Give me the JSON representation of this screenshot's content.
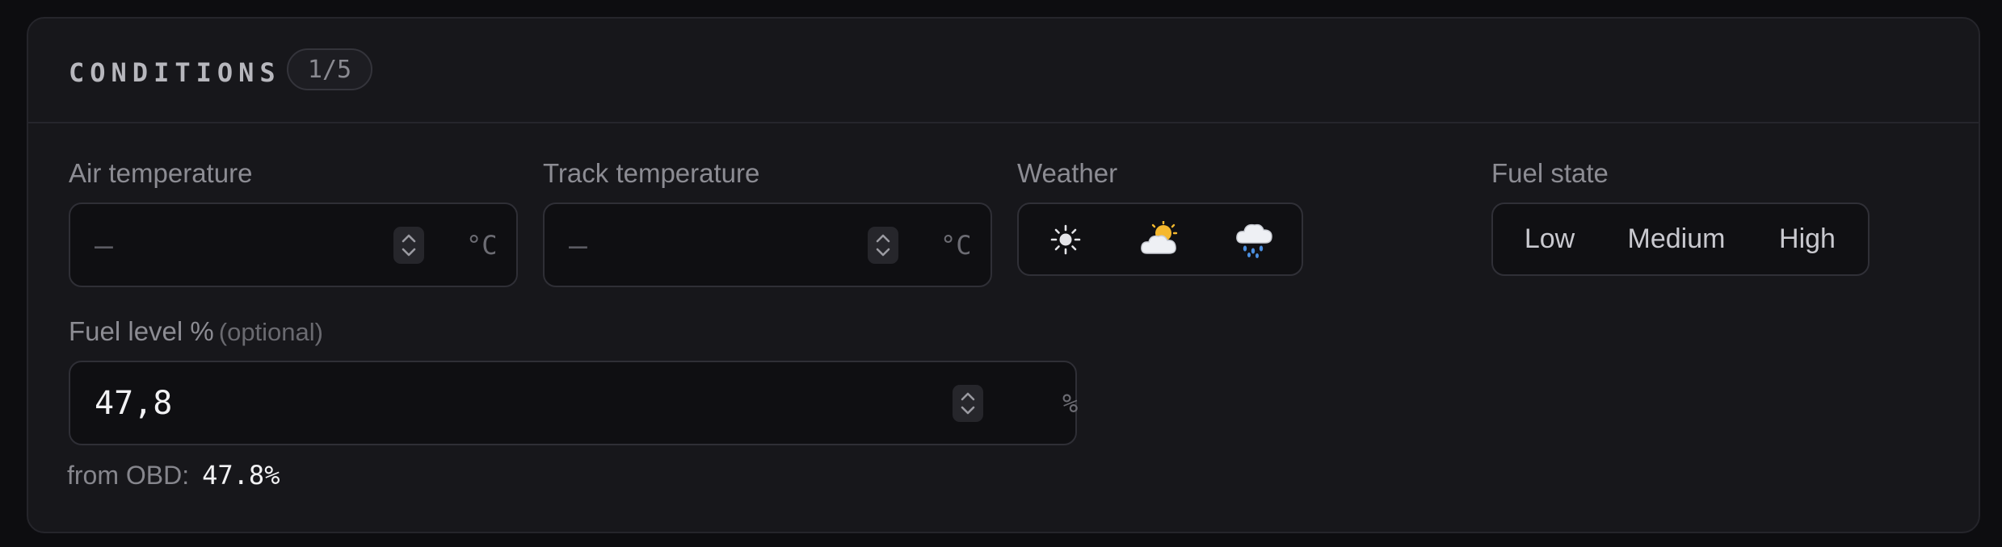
{
  "section": {
    "title": "CONDITIONS",
    "progress": "1/5"
  },
  "air_temperature": {
    "label": "Air temperature",
    "value": "—",
    "unit": "°C",
    "stepper_icon": "chevron-up-down-icon"
  },
  "track_temperature": {
    "label": "Track temperature",
    "value": "—",
    "unit": "°C",
    "stepper_icon": "chevron-up-down-icon"
  },
  "weather": {
    "label": "Weather",
    "options": [
      {
        "icon": "sun-icon",
        "glyph": "☀"
      },
      {
        "icon": "sun-behind-cloud-icon",
        "glyph": "🌥"
      },
      {
        "icon": "cloud-with-rain-icon",
        "glyph": "🌧"
      }
    ]
  },
  "fuel_state": {
    "label": "Fuel state",
    "options": [
      "Low",
      "Medium",
      "High"
    ]
  },
  "fuel_level": {
    "label": "Fuel level %",
    "optional_text": "(optional)",
    "value": "47,8",
    "unit": "%",
    "stepper_icon": "chevron-up-down-icon"
  },
  "obd": {
    "label": "from OBD:",
    "value": "47.8%"
  },
  "colors": {
    "panel_bg": "#17171b",
    "field_bg": "#0f0f12",
    "border": "#2f2f36",
    "text_muted": "#8c8c93",
    "text_bright": "#f2f2f4"
  }
}
